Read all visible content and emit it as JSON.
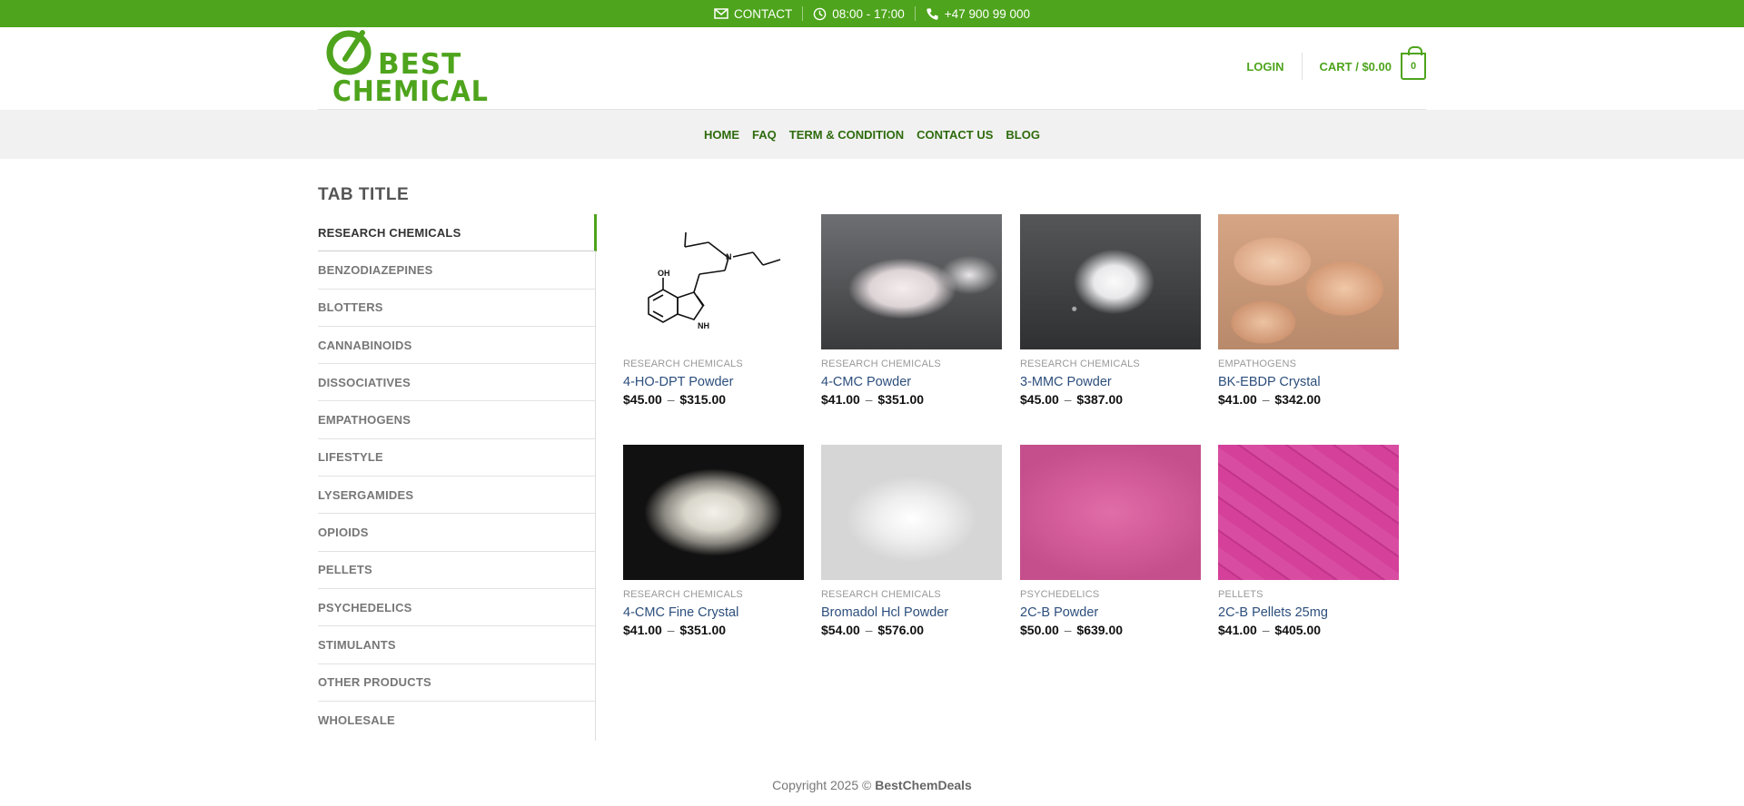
{
  "topbar": {
    "contact": "CONTACT",
    "hours": "08:00 - 17:00",
    "phone": "+47 900 99 000"
  },
  "header": {
    "logo_line1": "BEST",
    "logo_line2": "CHEMICAL",
    "login": "LOGIN",
    "cart": "CART / $0.00",
    "cart_count": "0"
  },
  "nav": [
    {
      "label": "HOME"
    },
    {
      "label": "FAQ"
    },
    {
      "label": "TERM & CONDITION"
    },
    {
      "label": "CONTACT US"
    },
    {
      "label": "BLOG"
    }
  ],
  "sidebar": {
    "title": "TAB TITLE",
    "categories": [
      "RESEARCH CHEMICALS",
      "BENZODIAZEPINES",
      "BLOTTERS",
      "CANNABINOIDS",
      "DISSOCIATIVES",
      "EMPATHOGENS",
      "LIFESTYLE",
      "LYSERGAMIDES",
      "OPIOIDS",
      "PELLETS",
      "PSYCHEDELICS",
      "STIMULANTS",
      "OTHER PRODUCTS",
      "WHOLESALE"
    ]
  },
  "products": [
    {
      "category": "RESEARCH CHEMICALS",
      "name": "4-HO-DPT Powder",
      "price_min": "$45.00",
      "price_max": "$315.00",
      "image": "molecule"
    },
    {
      "category": "RESEARCH CHEMICALS",
      "name": "4-CMC Powder",
      "price_min": "$41.00",
      "price_max": "$351.00",
      "image": "4cmc"
    },
    {
      "category": "RESEARCH CHEMICALS",
      "name": "3-MMC Powder",
      "price_min": "$45.00",
      "price_max": "$387.00",
      "image": "3mmc"
    },
    {
      "category": "EMPATHOGENS",
      "name": "BK-EBDP Crystal",
      "price_min": "$41.00",
      "price_max": "$342.00",
      "image": "bkebdp"
    },
    {
      "category": "RESEARCH CHEMICALS",
      "name": "4-CMC Fine Crystal",
      "price_min": "$41.00",
      "price_max": "$351.00",
      "image": "crystal"
    },
    {
      "category": "RESEARCH CHEMICALS",
      "name": "Bromadol Hcl Powder",
      "price_min": "$54.00",
      "price_max": "$576.00",
      "image": "bromadol"
    },
    {
      "category": "PSYCHEDELICS",
      "name": "2C-B Powder",
      "price_min": "$50.00",
      "price_max": "$639.00",
      "image": "2cb"
    },
    {
      "category": "PELLETS",
      "name": "2C-B Pellets 25mg",
      "price_min": "$41.00",
      "price_max": "$405.00",
      "image": "pellets"
    }
  ],
  "molecule_labels": {
    "oh": "OH",
    "n": "N",
    "nh": "NH"
  },
  "footer": {
    "copyright": "Copyright 2025 ©",
    "brand": "BestChemDeals"
  },
  "colors": {
    "brand_green": "#4ea41c",
    "nav_green": "#2e6b0d",
    "link_blue": "#2c4e7c"
  }
}
